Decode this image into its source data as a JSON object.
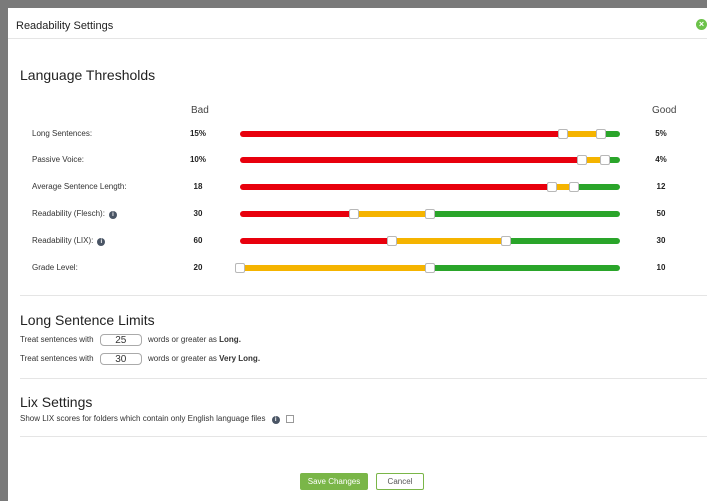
{
  "dialog": {
    "title": "Readability Settings",
    "close_icon": "close-icon"
  },
  "thresholds": {
    "heading": "Language Thresholds",
    "bad_label": "Bad",
    "good_label": "Good",
    "colors": {
      "red": "#e8000d",
      "yellow": "#f5b400",
      "green": "#2aa52a"
    },
    "rows": [
      {
        "label": "Long Sentences:",
        "bad": "15%",
        "good": "5%",
        "info": false,
        "handles": [
          0.85,
          0.95
        ]
      },
      {
        "label": "Passive Voice:",
        "bad": "10%",
        "good": "4%",
        "info": false,
        "handles": [
          0.9,
          0.96
        ]
      },
      {
        "label": "Average Sentence Length:",
        "bad": "18",
        "good": "12",
        "info": false,
        "handles": [
          0.82,
          0.88
        ]
      },
      {
        "label": "Readability (Flesch):",
        "bad": "30",
        "good": "50",
        "info": true,
        "handles": [
          0.3,
          0.5
        ]
      },
      {
        "label": "Readability (LIX):",
        "bad": "60",
        "good": "30",
        "info": true,
        "handles": [
          0.4,
          0.7
        ]
      },
      {
        "label": "Grade Level:",
        "bad": "20",
        "good": "10",
        "info": false,
        "handles": [
          0.0,
          0.5
        ]
      }
    ]
  },
  "long_sentence": {
    "heading": "Long Sentence Limits",
    "prefix": "Treat sentences with",
    "long_value": "25",
    "long_suffix": "words or greater as",
    "long_word": "Long.",
    "very_long_value": "30",
    "very_long_word": "Very Long."
  },
  "lix": {
    "heading": "Lix Settings",
    "text": "Show LIX scores for folders which contain only English language files"
  },
  "buttons": {
    "save": "Save Changes",
    "cancel": "Cancel"
  }
}
